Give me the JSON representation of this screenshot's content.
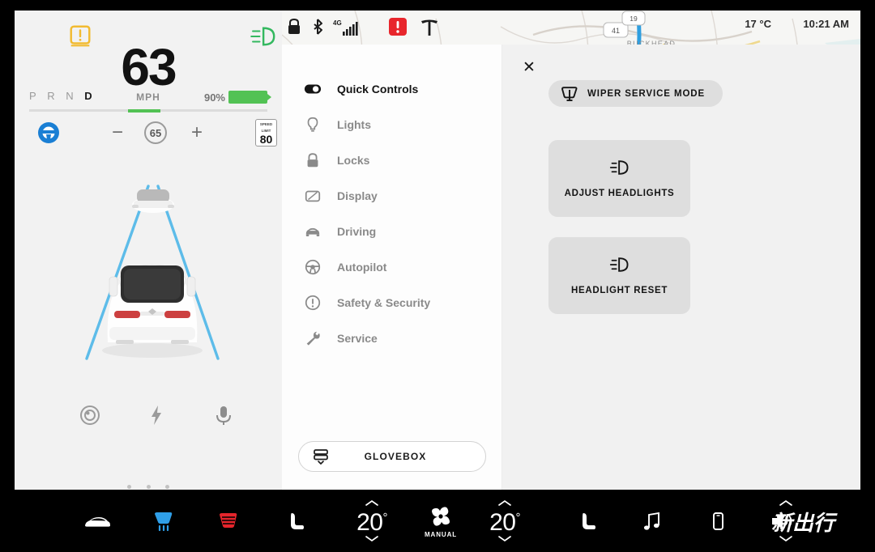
{
  "cluster": {
    "speed": "63",
    "speed_unit": "MPH",
    "gear_sequence": [
      "P",
      "R",
      "N"
    ],
    "gear_active": "D",
    "battery_percent": "90%",
    "battery_color": "#52c254",
    "cruise_set_speed": "65",
    "speed_limit_label_line1": "SPEED",
    "speed_limit_label_line2": "LIMIT",
    "speed_limit_value": "80",
    "warning_icon": "tpms-warning-icon",
    "warning_color": "#f2bb31",
    "headlight_icon": "headlight-indicator-icon",
    "headlight_color": "#33b85f",
    "autopilot_wheel_color": "#1a7fd4",
    "bottom_icons": [
      "camera-icon",
      "charge-bolt-icon",
      "microphone-icon"
    ],
    "page_dots": 3
  },
  "statusbar": {
    "lock_icon": "lock-icon",
    "bluetooth_icon": "bluetooth-icon",
    "network_label": "4G",
    "signal_icon": "signal-bars-icon",
    "alert_icon": "alert-exclamation-icon",
    "alert_color": "#e8262c",
    "brand_icon": "tesla-logo-icon",
    "temperature": "17 °C",
    "time": "10:21 AM"
  },
  "map": {
    "place_labels": [
      "BUCKHEAD"
    ],
    "route_shield_labels": [
      "41",
      "19"
    ],
    "route_color": "#2f9fe0",
    "background_color": "#f6f6f4",
    "water_color": "#b9dfe3"
  },
  "menu": {
    "items": [
      {
        "label": "Quick Controls",
        "icon": "quick-controls-toggle-icon",
        "active": true
      },
      {
        "label": "Lights",
        "icon": "lightbulb-icon",
        "active": false
      },
      {
        "label": "Locks",
        "icon": "padlock-icon",
        "active": false
      },
      {
        "label": "Display",
        "icon": "display-screen-icon",
        "active": false
      },
      {
        "label": "Driving",
        "icon": "car-front-icon",
        "active": false
      },
      {
        "label": "Autopilot",
        "icon": "steering-wheel-icon",
        "active": false
      },
      {
        "label": "Safety & Security",
        "icon": "exclamation-circle-icon",
        "active": false
      },
      {
        "label": "Service",
        "icon": "wrench-icon",
        "active": false
      }
    ],
    "glovebox_label": "GLOVEBOX",
    "glovebox_icon": "glovebox-icon"
  },
  "content": {
    "close_label": "✕",
    "wiper_button": {
      "label": "WIPER SERVICE MODE",
      "icon": "wiper-blade-icon"
    },
    "tiles": [
      {
        "label": "ADJUST HEADLIGHTS",
        "icon": "headlight-icon"
      },
      {
        "label": "HEADLIGHT RESET",
        "icon": "headlight-icon"
      }
    ]
  },
  "bottombar": {
    "car_icon": "car-profile-icon",
    "front_defrost_icon": "front-defrost-icon",
    "front_defrost_color": "#2f9fe8",
    "rear_defrost_icon": "rear-defrost-icon",
    "rear_defrost_color": "#e5252c",
    "seat_left_icon": "seat-heater-left-icon",
    "seat_right_icon": "seat-heater-right-icon",
    "media_icon": "music-note-icon",
    "phone_icon": "phone-icon",
    "volume_icon": "volume-speaker-icon",
    "temp_left": "20",
    "temp_right": "20",
    "temp_degree": "°",
    "fan_icon": "fan-icon",
    "fan_mode_label": "MANUAL",
    "chevron_up_icon": "chevron-up-icon",
    "chevron_down_icon": "chevron-down-icon"
  },
  "watermark": {
    "text": "新出行"
  }
}
